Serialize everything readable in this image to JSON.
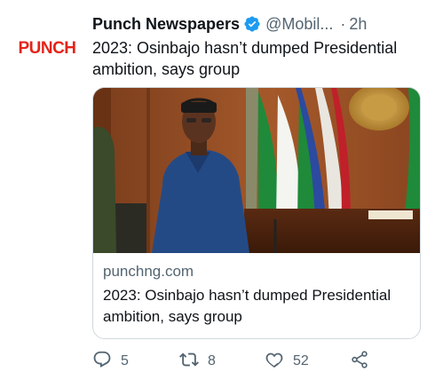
{
  "tweet": {
    "author_name": "Punch Newspapers",
    "handle": "@Mobil...",
    "separator": "·",
    "time": "2h",
    "text": "2023: Osinbajo hasn’t dumped Presidential ambition, says group",
    "avatar_logo": "PUNCH",
    "card": {
      "domain": "punchng.com",
      "title": "2023: Osinbajo hasn’t dumped Presidential ambition, says group"
    },
    "actions": {
      "replies": "5",
      "retweets": "8",
      "likes": "52"
    }
  },
  "colors": {
    "verified": "#1d9bf0",
    "brand_red": "#e3241b",
    "muted": "#536471"
  },
  "icons": [
    "verified-badge-icon",
    "reply-icon",
    "retweet-icon",
    "like-icon",
    "share-icon"
  ]
}
